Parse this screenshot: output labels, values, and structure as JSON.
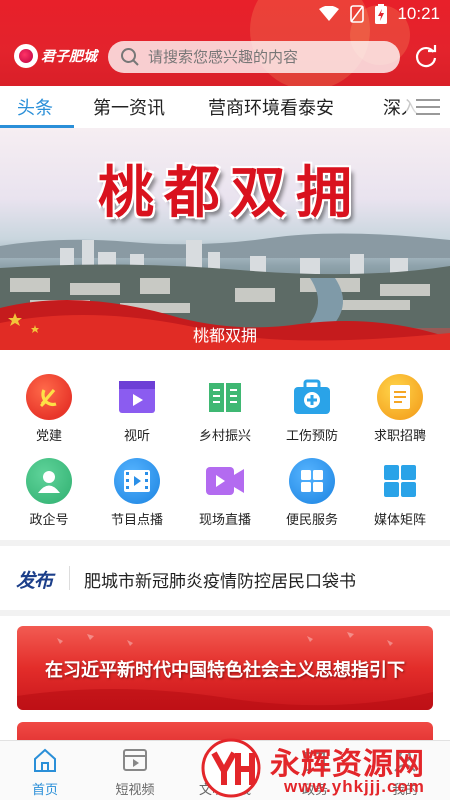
{
  "status_bar": {
    "time": "10:21"
  },
  "header": {
    "logo_text": "君子肥城",
    "search_placeholder": "请搜索您感兴趣的内容"
  },
  "tabs": [
    {
      "label": "头条",
      "active": true
    },
    {
      "label": "第一资讯"
    },
    {
      "label": "营商环境看泰安"
    },
    {
      "label": "深入"
    }
  ],
  "banner": {
    "title": "桃都双拥",
    "caption": "桃都双拥"
  },
  "grid": [
    {
      "label": "党建",
      "icon": "party-emblem-icon",
      "color": "#e8362a"
    },
    {
      "label": "视听",
      "icon": "video-icon",
      "color": "#8b5cf0"
    },
    {
      "label": "乡村振兴",
      "icon": "book-icon",
      "color": "#3fb873"
    },
    {
      "label": "工伤预防",
      "icon": "medical-kit-icon",
      "color": "#2aa3e8"
    },
    {
      "label": "求职招聘",
      "icon": "document-icon",
      "color": "#f5a623"
    },
    {
      "label": "政企号",
      "icon": "person-icon",
      "color": "#3bb87a"
    },
    {
      "label": "节目点播",
      "icon": "film-icon",
      "color": "#2a8fe8"
    },
    {
      "label": "现场直播",
      "icon": "camera-icon",
      "color": "#b36bf0"
    },
    {
      "label": "便民服务",
      "icon": "windows-grid-icon",
      "color": "#2a8fe8"
    },
    {
      "label": "媒体矩阵",
      "icon": "tiles-icon",
      "color": "#2aa3e8"
    }
  ],
  "notice": {
    "tag": "发布",
    "text": "肥城市新冠肺炎疫情防控居民口袋书"
  },
  "feed": {
    "card1_text": "在习近平新时代中国特色社会主义思想指引下"
  },
  "bottom_nav": [
    {
      "label": "首页",
      "icon": "home-icon",
      "active": true
    },
    {
      "label": "短视频",
      "icon": "short-video-icon"
    },
    {
      "label": "文明实践",
      "icon": "civilization-icon"
    },
    {
      "label": "政务",
      "icon": "government-icon"
    },
    {
      "label": "我的",
      "icon": "user-icon"
    }
  ],
  "watermark": {
    "text": "永辉资源网",
    "url": "www.yhkjjj.com"
  },
  "colors": {
    "brand_red": "#e3232c",
    "accent_blue": "#2a8fd8"
  }
}
